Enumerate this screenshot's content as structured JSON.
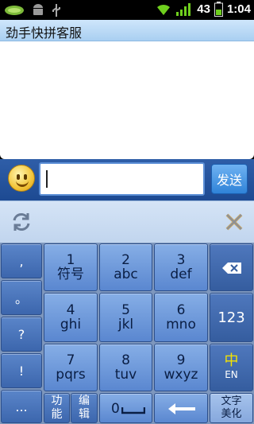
{
  "status_bar": {
    "battery_percent": "43",
    "time": "1:04",
    "icons": [
      "leaf-notification-icon",
      "android-icon",
      "usb-icon",
      "wifi-icon",
      "signal-icon",
      "battery-icon"
    ]
  },
  "title": "劲手快拼客服",
  "input": {
    "value": "",
    "send_label": "发送"
  },
  "keyboard": {
    "side_keys": [
      ",",
      "。",
      "?",
      "!",
      "..."
    ],
    "num_keys": [
      {
        "digit": "1",
        "letters": "符号"
      },
      {
        "digit": "2",
        "letters": "abc"
      },
      {
        "digit": "3",
        "letters": "def"
      },
      {
        "digit": "4",
        "letters": "ghi"
      },
      {
        "digit": "5",
        "letters": "jkl"
      },
      {
        "digit": "6",
        "letters": "mno"
      },
      {
        "digit": "7",
        "letters": "pqrs"
      },
      {
        "digit": "8",
        "letters": "tuv"
      },
      {
        "digit": "9",
        "letters": "wxyz"
      }
    ],
    "right_keys": {
      "num_mode": "123",
      "lang_main": "中",
      "lang_sub": "EN"
    },
    "bottom": {
      "func_1": "功",
      "func_2": "能",
      "edit_1": "编",
      "edit_2": "辑",
      "zero": "0",
      "style_1": "文字",
      "style_2": "美化"
    }
  },
  "colors": {
    "accent": "#2f83d8",
    "keyboard_key": "#5a87d0",
    "lang_active": "#f5e300"
  }
}
